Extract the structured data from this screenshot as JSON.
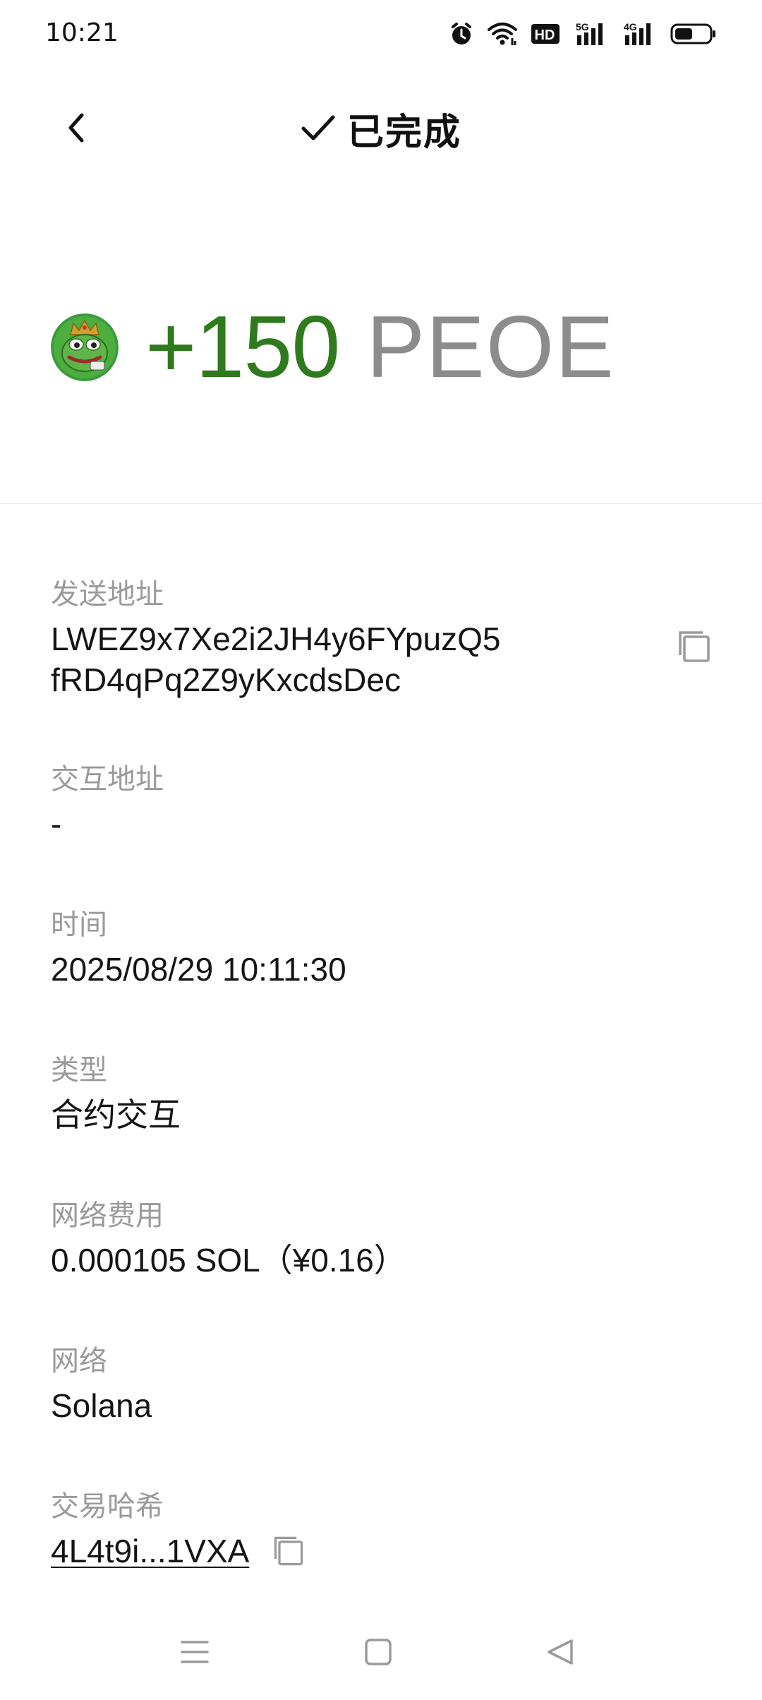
{
  "status_bar": {
    "time": "10:21",
    "icons": [
      "alarm-icon",
      "wifi-icon",
      "hd-icon",
      "signal-5g-icon",
      "signal-4g-icon",
      "battery-icon"
    ],
    "hd_label": "HD",
    "net1_label": "5G",
    "net2_label": "4G"
  },
  "header": {
    "status_title": "已完成",
    "back_icon": "chevron-left-icon",
    "status_icon": "checkmark-icon"
  },
  "amount": {
    "value": "+150",
    "symbol": "PEOE",
    "token_icon": "pepe-token-icon",
    "value_color": "#2f7a1d"
  },
  "details": {
    "sender": {
      "label": "发送地址",
      "line1": "LWEZ9x7Xe2i2JH4y6FYpuzQ5",
      "line2": "fRD4qPq2Z9yKxcdsDec"
    },
    "interaction": {
      "label": "交互地址",
      "value": "-"
    },
    "time": {
      "label": "时间",
      "value": "2025/08/29 10:11:30"
    },
    "type": {
      "label": "类型",
      "value": "合约交互"
    },
    "fee": {
      "label": "网络费用",
      "value": "0.000105 SOL（¥0.16）"
    },
    "network": {
      "label": "网络",
      "value": "Solana"
    },
    "hash": {
      "label": "交易哈希",
      "value": "4L4t9i...1VXA"
    }
  },
  "nav": {
    "icons": [
      "menu-icon",
      "home-square-icon",
      "back-triangle-icon"
    ]
  }
}
